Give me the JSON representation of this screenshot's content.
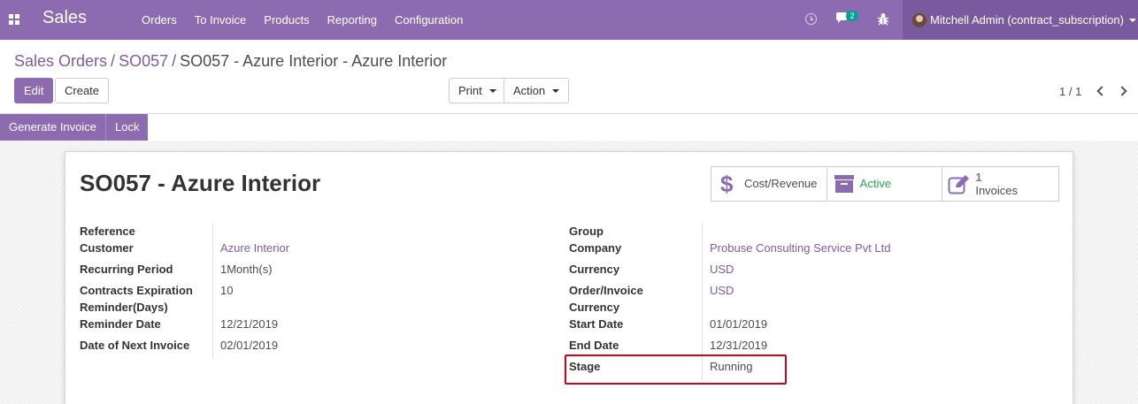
{
  "navbar": {
    "app_name": "Sales",
    "menu": [
      "Orders",
      "To Invoice",
      "Products",
      "Reporting",
      "Configuration"
    ],
    "message_count": "2",
    "user_name": "Mitchell Admin (contract_subscription)",
    "icons": [
      "apps-grid-icon",
      "clock-icon",
      "chat-icon",
      "bug-icon"
    ],
    "background_color": "#8c6bb1"
  },
  "breadcrumb": {
    "items": [
      "Sales Orders",
      "SO057"
    ],
    "current": "SO057 - Azure Interior - Azure Interior"
  },
  "toolbar": {
    "edit_label": "Edit",
    "create_label": "Create",
    "print_label": "Print",
    "action_label": "Action"
  },
  "pager": {
    "value": "1 / 1"
  },
  "statusbar": {
    "generate_invoice_label": "Generate Invoice",
    "lock_label": "Lock"
  },
  "form": {
    "title": "SO057 - Azure Interior",
    "smart_buttons": {
      "cost_revenue": "Cost/Revenue",
      "active": "Active",
      "invoice_count": "1",
      "invoice_label": "Invoices"
    },
    "left": {
      "reference_label": "Reference",
      "reference_value": "",
      "customer_label": "Customer",
      "customer_value": "Azure Interior",
      "recurring_period_label": "Recurring Period",
      "recurring_period_value": "1Month(s)",
      "contracts_expiration_label_1": "Contracts Expiration",
      "contracts_expiration_label_2": "Reminder(Days)",
      "contracts_expiration_value": "10",
      "reminder_date_label": "Reminder Date",
      "reminder_date_value": "12/21/2019",
      "next_invoice_label": "Date of Next Invoice",
      "next_invoice_value": "02/01/2019"
    },
    "right": {
      "group_label": "Group",
      "group_value": "",
      "company_label": "Company",
      "company_value": "Probuse Consulting Service Pvt Ltd",
      "currency_label": "Currency",
      "currency_value": "USD",
      "order_invoice_currency_label_1": "Order/Invoice",
      "order_invoice_currency_label_2": "Currency",
      "order_invoice_currency_value": "USD",
      "start_date_label": "Start Date",
      "start_date_value": "01/01/2019",
      "end_date_label": "End Date",
      "end_date_value": "12/31/2019",
      "stage_label": "Stage",
      "stage_value": "Running"
    }
  },
  "colors": {
    "accent": "#8c6bb1",
    "link": "#7d5ba6",
    "active_green": "#28a745",
    "highlight_red": "#d0021b"
  }
}
